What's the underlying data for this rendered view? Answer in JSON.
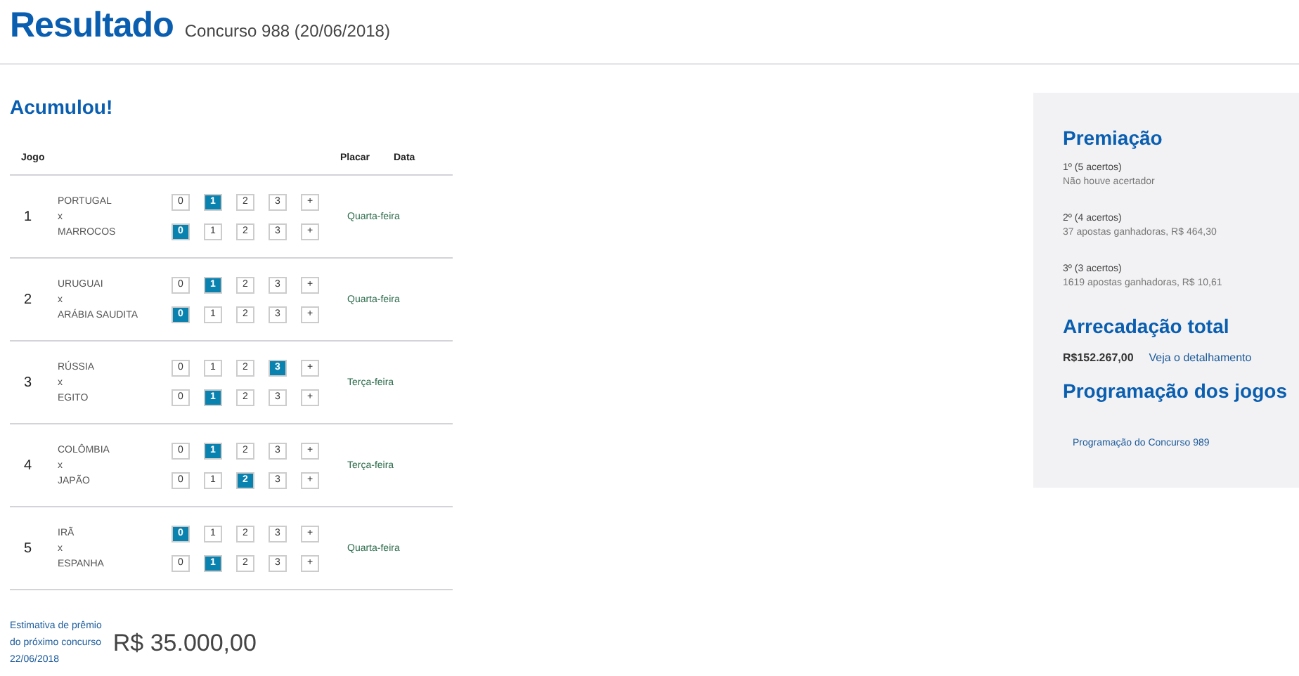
{
  "header": {
    "title": "Resultado",
    "subtitle": "Concurso 988 (20/06/2018)"
  },
  "status": "Acumulou!",
  "table": {
    "columns": [
      "Jogo",
      "Placar",
      "Data"
    ],
    "games": [
      {
        "number": "1",
        "separator": "x",
        "date": "Quarta-feira",
        "teams": [
          {
            "name": "PORTUGAL",
            "options": [
              {
                "label": "0",
                "selected": false
              },
              {
                "label": "1",
                "selected": true
              },
              {
                "label": "2",
                "selected": false
              },
              {
                "label": "3",
                "selected": false
              },
              {
                "label": "+",
                "selected": false
              }
            ]
          },
          {
            "name": "MARROCOS",
            "options": [
              {
                "label": "0",
                "selected": true
              },
              {
                "label": "1",
                "selected": false
              },
              {
                "label": "2",
                "selected": false
              },
              {
                "label": "3",
                "selected": false
              },
              {
                "label": "+",
                "selected": false
              }
            ]
          }
        ]
      },
      {
        "number": "2",
        "separator": "x",
        "date": "Quarta-feira",
        "teams": [
          {
            "name": "URUGUAI",
            "options": [
              {
                "label": "0",
                "selected": false
              },
              {
                "label": "1",
                "selected": true
              },
              {
                "label": "2",
                "selected": false
              },
              {
                "label": "3",
                "selected": false
              },
              {
                "label": "+",
                "selected": false
              }
            ]
          },
          {
            "name": "ARÁBIA SAUDITA",
            "options": [
              {
                "label": "0",
                "selected": true
              },
              {
                "label": "1",
                "selected": false
              },
              {
                "label": "2",
                "selected": false
              },
              {
                "label": "3",
                "selected": false
              },
              {
                "label": "+",
                "selected": false
              }
            ]
          }
        ]
      },
      {
        "number": "3",
        "separator": "x",
        "date": "Terça-feira",
        "teams": [
          {
            "name": "RÚSSIA",
            "options": [
              {
                "label": "0",
                "selected": false
              },
              {
                "label": "1",
                "selected": false
              },
              {
                "label": "2",
                "selected": false
              },
              {
                "label": "3",
                "selected": true
              },
              {
                "label": "+",
                "selected": false
              }
            ]
          },
          {
            "name": "EGITO",
            "options": [
              {
                "label": "0",
                "selected": false
              },
              {
                "label": "1",
                "selected": true
              },
              {
                "label": "2",
                "selected": false
              },
              {
                "label": "3",
                "selected": false
              },
              {
                "label": "+",
                "selected": false
              }
            ]
          }
        ]
      },
      {
        "number": "4",
        "separator": "x",
        "date": "Terça-feira",
        "teams": [
          {
            "name": "COLÔMBIA",
            "options": [
              {
                "label": "0",
                "selected": false
              },
              {
                "label": "1",
                "selected": true
              },
              {
                "label": "2",
                "selected": false
              },
              {
                "label": "3",
                "selected": false
              },
              {
                "label": "+",
                "selected": false
              }
            ]
          },
          {
            "name": "JAPÃO",
            "options": [
              {
                "label": "0",
                "selected": false
              },
              {
                "label": "1",
                "selected": false
              },
              {
                "label": "2",
                "selected": true
              },
              {
                "label": "3",
                "selected": false
              },
              {
                "label": "+",
                "selected": false
              }
            ]
          }
        ]
      },
      {
        "number": "5",
        "separator": "x",
        "date": "Quarta-feira",
        "teams": [
          {
            "name": "IRÃ",
            "options": [
              {
                "label": "0",
                "selected": true
              },
              {
                "label": "1",
                "selected": false
              },
              {
                "label": "2",
                "selected": false
              },
              {
                "label": "3",
                "selected": false
              },
              {
                "label": "+",
                "selected": false
              }
            ]
          },
          {
            "name": "ESPANHA",
            "options": [
              {
                "label": "0",
                "selected": false
              },
              {
                "label": "1",
                "selected": true
              },
              {
                "label": "2",
                "selected": false
              },
              {
                "label": "3",
                "selected": false
              },
              {
                "label": "+",
                "selected": false
              }
            ]
          }
        ]
      }
    ]
  },
  "estimate": {
    "label_lines": [
      "Estimativa de prêmio",
      "do próximo concurso",
      "22/06/2018"
    ],
    "value": "R$ 35.000,00"
  },
  "sidebar": {
    "prizes_title": "Premiação",
    "prizes": [
      {
        "tier": "1º (5 acertos)",
        "result": "Não houve acertador"
      },
      {
        "tier": "2º (4 acertos)",
        "result": "37 apostas ganhadoras, R$ 464,30"
      },
      {
        "tier": "3º (3 acertos)",
        "result": "1619 apostas ganhadoras, R$ 10,61"
      }
    ],
    "total_title": "Arrecadação total",
    "total_value": "R$152.267,00",
    "total_link": "Veja o detalhamento",
    "schedule_title": "Programação dos jogos",
    "schedule_link": "Programação do Concurso 989"
  }
}
